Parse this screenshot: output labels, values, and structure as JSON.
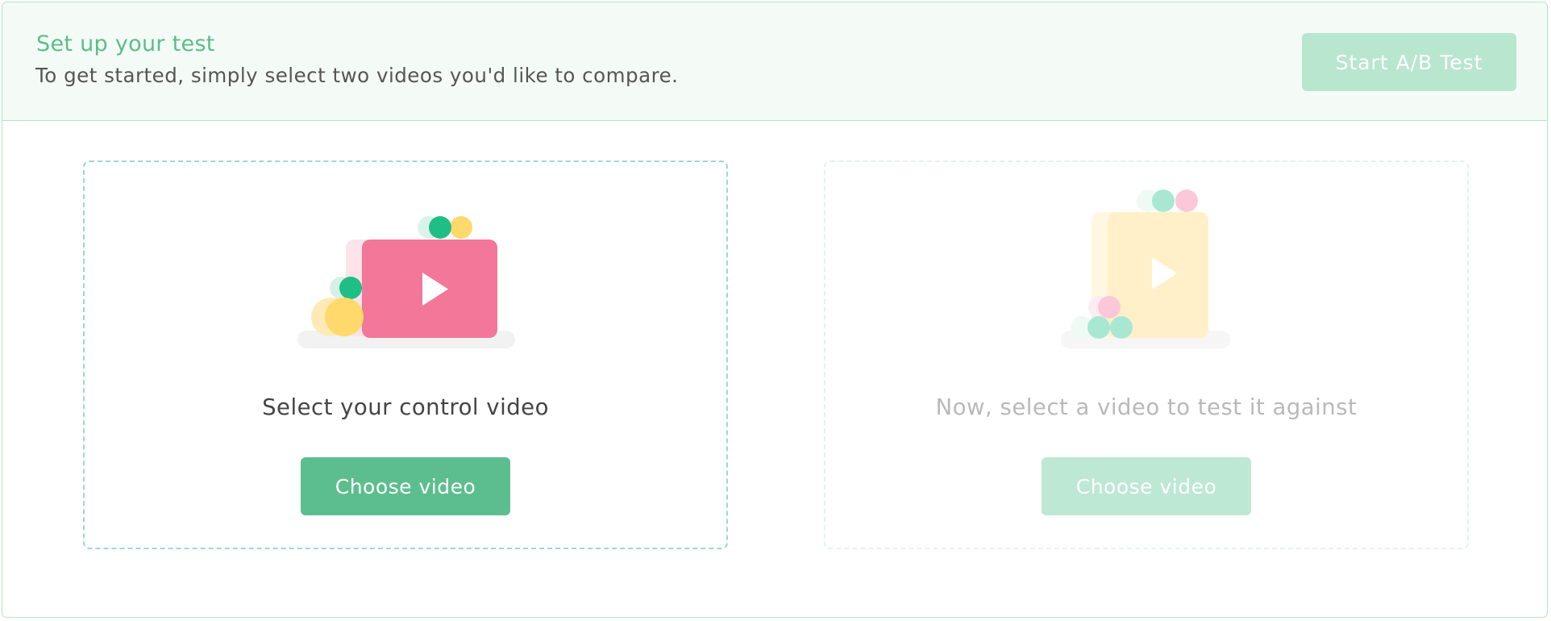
{
  "header": {
    "title": "Set up your test",
    "subtitle": "To get started, simply select two videos you'd like to compare.",
    "start_button_label": "Start A/B Test"
  },
  "cards": [
    {
      "label": "Select your control video",
      "button_label": "Choose video",
      "illustration": "pink-video-player-icon",
      "accent_color": "#f27799"
    },
    {
      "label": "Now, select a video to test it against",
      "button_label": "Choose video",
      "illustration": "yellow-video-player-icon",
      "accent_color": "#fff0c9"
    }
  ],
  "colors": {
    "brand_green": "#5cbe8e",
    "disabled_green": "#b9e6cf",
    "header_background": "#f4fbf6",
    "border": "#b6e3c8"
  }
}
